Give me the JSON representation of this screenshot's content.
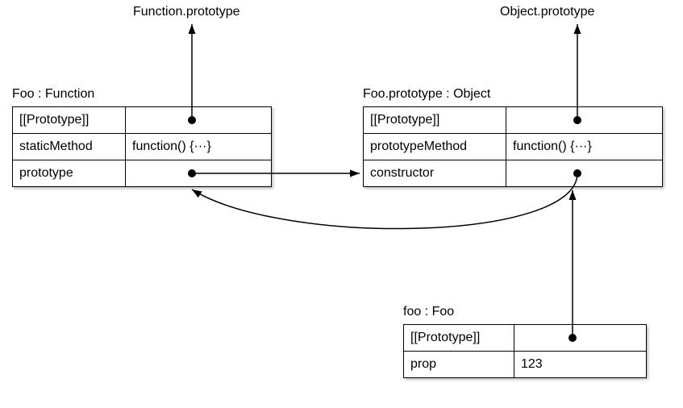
{
  "labels": {
    "functionPrototype": "Function.prototype",
    "objectPrototype": "Object.prototype"
  },
  "fooBox": {
    "title": "Foo : Function",
    "rows": {
      "proto": "[[Prototype]]",
      "staticMethod": "staticMethod",
      "staticMethodVal": "function() {···}",
      "prototype": "prototype"
    },
    "leftColWidth": 123
  },
  "fooProtoBox": {
    "title": "Foo.prototype : Object",
    "rows": {
      "proto": "[[Prototype]]",
      "prototypeMethod": "prototypeMethod",
      "prototypeMethodVal": "function() {···}",
      "constructor": "constructor"
    },
    "leftColWidth": 160
  },
  "fooInstBox": {
    "title": "foo : Foo",
    "rows": {
      "proto": "[[Prototype]]",
      "prop": "prop",
      "propVal": "123"
    },
    "leftColWidth": 120
  }
}
